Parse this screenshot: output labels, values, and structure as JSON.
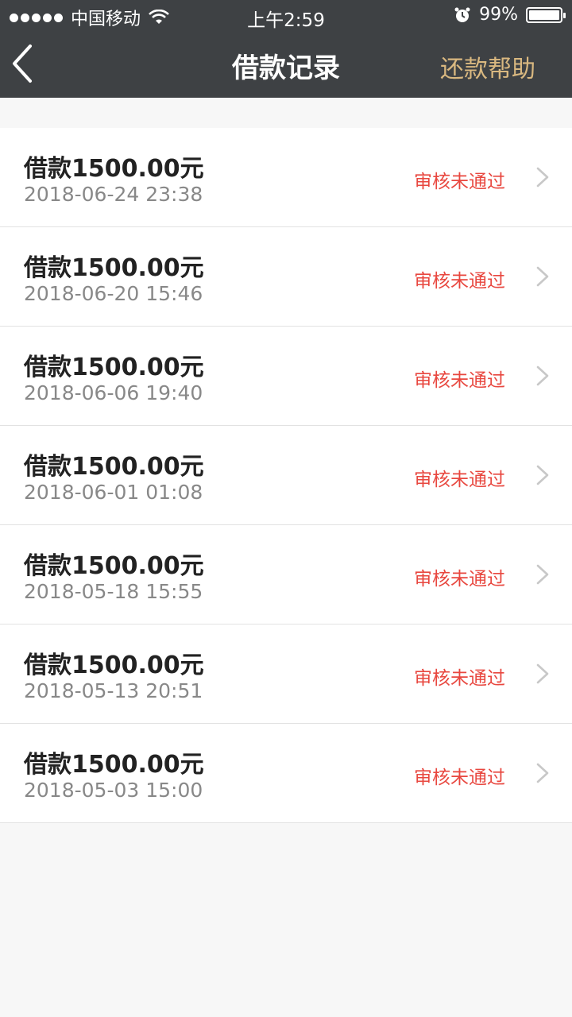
{
  "status_bar": {
    "carrier": "中国移动",
    "time": "上午2:59",
    "battery": "99%",
    "battery_level": 0.99
  },
  "nav": {
    "title": "借款记录",
    "help_label": "还款帮助"
  },
  "colors": {
    "header_bg": "#3e4144",
    "help_gold": "#d9b880",
    "status_red": "#e8473f",
    "page_bg": "#f7f7f7"
  },
  "records": [
    {
      "amount": "借款1500.00元",
      "date": "2018-06-24 23:38",
      "status": "审核未通过"
    },
    {
      "amount": "借款1500.00元",
      "date": "2018-06-20 15:46",
      "status": "审核未通过"
    },
    {
      "amount": "借款1500.00元",
      "date": "2018-06-06 19:40",
      "status": "审核未通过"
    },
    {
      "amount": "借款1500.00元",
      "date": "2018-06-01 01:08",
      "status": "审核未通过"
    },
    {
      "amount": "借款1500.00元",
      "date": "2018-05-18 15:55",
      "status": "审核未通过"
    },
    {
      "amount": "借款1500.00元",
      "date": "2018-05-13 20:51",
      "status": "审核未通过"
    },
    {
      "amount": "借款1500.00元",
      "date": "2018-05-03 15:00",
      "status": "审核未通过"
    }
  ]
}
